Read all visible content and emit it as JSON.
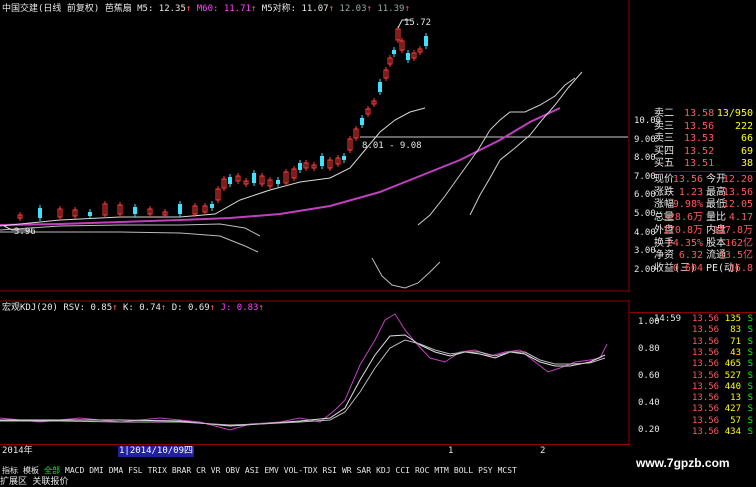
{
  "top_bar": {
    "stock": "中国交建(日线 前复权)",
    "indicator": "芭蕉扇",
    "ma5": "M5: 12.35",
    "m60": "M60: 11.71",
    "m5_ratio": "M5对称: 11.07",
    "v1": "12.03",
    "v2": "11.39"
  },
  "price_axis": [
    "10.00",
    "9.00",
    "8.00",
    "7.00",
    "6.00",
    "5.00",
    "4.00",
    "3.00",
    "2.00"
  ],
  "kdj_axis": [
    "1.00",
    "0.80",
    "0.60",
    "0.40",
    "0.20"
  ],
  "annotations": {
    "high": "15.72",
    "range": "8.01 - 9.08",
    "low": "3.96"
  },
  "kdj_header": {
    "name": "宏观KDJ(20)",
    "rsv": "RSV: 0.85",
    "k": "K: 0.74",
    "d": "D: 0.69",
    "j": "J: 0.83"
  },
  "x_axis": {
    "year": "2014年",
    "cursor_date": "1|2014/10/09四",
    "tick1": "1",
    "tick2": "2"
  },
  "order_book": [
    {
      "label": "卖二",
      "price": "13.58",
      "vol": "13/950"
    },
    {
      "label": "卖三",
      "price": "13.56",
      "vol": "222"
    },
    {
      "label": "卖三",
      "price": "13.53",
      "vol": "66"
    },
    {
      "label": "买四",
      "price": "13.52",
      "vol": "69"
    },
    {
      "label": "买五",
      "price": "13.51",
      "vol": "38"
    }
  ],
  "stats": [
    {
      "l1": "现价",
      "v1": "13.56",
      "l2": "今开",
      "v2": "12.20"
    },
    {
      "l1": "涨跌",
      "v1": "1.23",
      "l2": "最高",
      "v2": "13.56"
    },
    {
      "l1": "涨幅",
      "v1": "9.98%",
      "l2": "最低",
      "v2": "12.05"
    },
    {
      "l1": "总量",
      "v1": "328.6万",
      "l2": "量比",
      "v2": "4.17"
    },
    {
      "l1": "外盘",
      "v1": "170.8万",
      "l2": "内盘",
      "v2": "157.8万"
    },
    {
      "l1": "换手",
      "v1": "24.35%",
      "l2": "股本",
      "v2": "162亿"
    },
    {
      "l1": "净资",
      "v1": "6.32",
      "l2": "流通",
      "v2": "13.5亿"
    },
    {
      "l1": "收益(三)",
      "v1": "0.604",
      "l2": "PE(动)",
      "v2": "16.8"
    }
  ],
  "ticks": [
    {
      "time": "14:59",
      "price": "13.56",
      "vol": "135",
      "side": "S"
    },
    {
      "time": "",
      "price": "13.56",
      "vol": "83",
      "side": "S"
    },
    {
      "time": "",
      "price": "13.56",
      "vol": "71",
      "side": "S"
    },
    {
      "time": "",
      "price": "13.56",
      "vol": "43",
      "side": "S"
    },
    {
      "time": "",
      "price": "13.56",
      "vol": "465",
      "side": "S"
    },
    {
      "time": "",
      "price": "13.56",
      "vol": "527",
      "side": "S"
    },
    {
      "time": "",
      "price": "13.56",
      "vol": "440",
      "side": "S"
    },
    {
      "time": "",
      "price": "13.56",
      "vol": "13",
      "side": "S"
    },
    {
      "time": "",
      "price": "13.56",
      "vol": "427",
      "side": "S"
    },
    {
      "time": "",
      "price": "13.56",
      "vol": "57",
      "side": "S"
    },
    {
      "time": "",
      "price": "13.56",
      "vol": "434",
      "side": "S"
    }
  ],
  "bottom_tabs": [
    "指标",
    "模板",
    "全部",
    "MACD",
    "DMI",
    "DMA",
    "FSL",
    "TRIX",
    "BRAR",
    "CR",
    "VR",
    "OBV",
    "ASI",
    "EMV",
    "VOL-TDX",
    "RSI",
    "WR",
    "SAR",
    "KDJ",
    "CCI",
    "ROC",
    "MTM",
    "BOLL",
    "PSY",
    "MCST"
  ],
  "status_bar": "扩展区 关联报价",
  "watermark": "www.7gpzb.com"
}
